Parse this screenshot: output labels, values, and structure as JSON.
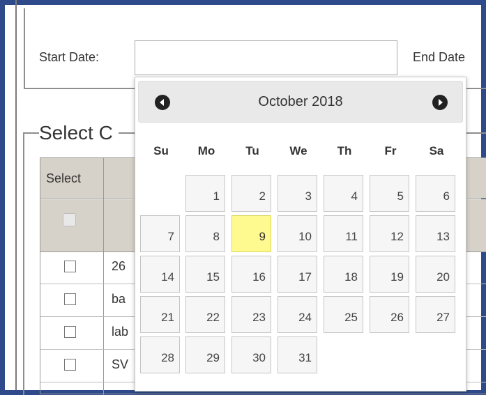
{
  "form": {
    "start_date_label": "Start Date:",
    "end_date_label": "End Date",
    "start_date_value": ""
  },
  "section": {
    "legend": "Select C",
    "select_header": "Select",
    "rows": [
      {
        "text": "26"
      },
      {
        "text": "ba"
      },
      {
        "text": "lab"
      },
      {
        "text": "SV"
      }
    ]
  },
  "datepicker": {
    "title": "October 2018",
    "prev_icon": "circle-triangle-left-icon",
    "next_icon": "circle-triangle-right-icon",
    "weekdays": [
      "Su",
      "Mo",
      "Tu",
      "We",
      "Th",
      "Fr",
      "Sa"
    ],
    "days": [
      "1",
      "2",
      "3",
      "4",
      "5",
      "6",
      "7",
      "8",
      "9",
      "10",
      "11",
      "12",
      "13",
      "14",
      "15",
      "16",
      "17",
      "18",
      "19",
      "20",
      "21",
      "22",
      "23",
      "24",
      "25",
      "26",
      "27",
      "28",
      "29",
      "30",
      "31"
    ],
    "highlight_day": "9",
    "highlight_color": "#fffa90"
  },
  "colors": {
    "frame": "#2f4a8a",
    "grid_header": "#d7d2c9"
  }
}
